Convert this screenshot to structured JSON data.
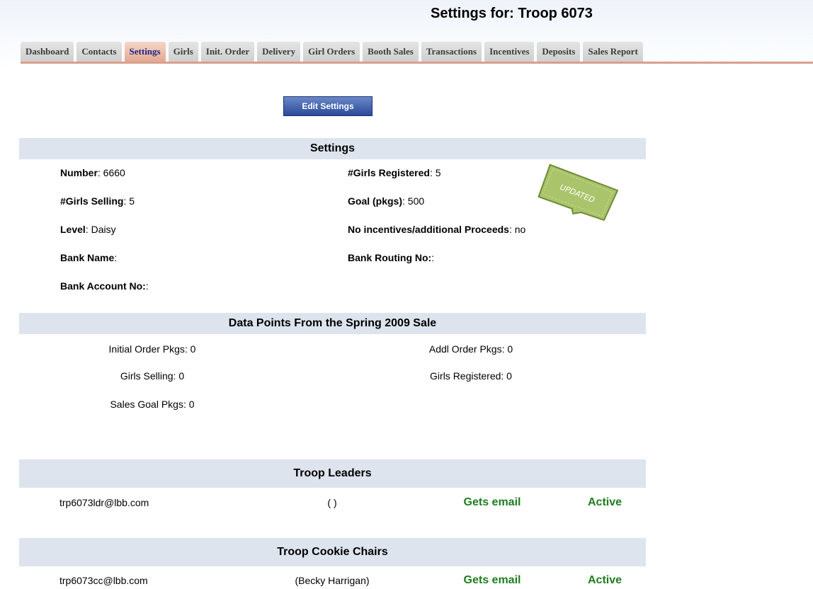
{
  "header": {
    "title": "Settings for:  Troop 6073"
  },
  "tabs": [
    {
      "label": "Dashboard",
      "active": false
    },
    {
      "label": "Contacts",
      "active": false
    },
    {
      "label": "Settings",
      "active": true
    },
    {
      "label": "Girls",
      "active": false
    },
    {
      "label": "Init. Order",
      "active": false
    },
    {
      "label": "Delivery",
      "active": false
    },
    {
      "label": "Girl Orders",
      "active": false
    },
    {
      "label": "Booth Sales",
      "active": false
    },
    {
      "label": "Transactions",
      "active": false
    },
    {
      "label": "Incentives",
      "active": false
    },
    {
      "label": "Deposits",
      "active": false
    },
    {
      "label": "Sales Report",
      "active": false
    }
  ],
  "edit_button": "Edit Settings",
  "settings": {
    "heading": "Settings",
    "number": {
      "label": "Number",
      "value": ": 6660"
    },
    "girls_registered": {
      "label": "#Girls Registered",
      "value": ": 5"
    },
    "girls_selling": {
      "label": "#Girls Selling",
      "value": ": 5"
    },
    "goal": {
      "label": "Goal (pkgs)",
      "value": ": 500"
    },
    "level": {
      "label": "Level",
      "value": ": Daisy"
    },
    "no_incentives": {
      "label": "No incentives/additional Proceeds",
      "value": ": no"
    },
    "bank_name": {
      "label": "Bank Name",
      "value": ":"
    },
    "bank_routing": {
      "label": "Bank Routing No:",
      "value": ":"
    },
    "bank_account": {
      "label": "Bank Account No:",
      "value": ":"
    },
    "stamp": "UPDATED"
  },
  "data_points": {
    "heading": "Data Points From the Spring 2009 Sale",
    "initial_order": "Initial Order Pkgs: 0",
    "addl_order": "Addl Order Pkgs: 0",
    "girls_selling": "Girls Selling: 0",
    "girls_registered": "Girls Registered: 0",
    "sales_goal": "Sales Goal Pkgs: 0"
  },
  "troop_leaders": {
    "heading": "Troop Leaders",
    "rows": [
      {
        "email": "trp6073ldr@lbb.com",
        "name": "( )",
        "gets_email": "Gets email",
        "status": "Active"
      }
    ]
  },
  "cookie_chairs": {
    "heading": "Troop Cookie Chairs",
    "rows": [
      {
        "email": "trp6073cc@lbb.com",
        "name": "(Becky Harrigan)",
        "gets_email": "Gets email",
        "status": "Active"
      }
    ]
  },
  "colors": {
    "tab_active_bg": "#e2a995",
    "section_header_bg": "#dde4ee",
    "status_green": "#1e7d1e",
    "button_blue": "#2a4a9a",
    "stamp_green": "#a9c46a"
  }
}
